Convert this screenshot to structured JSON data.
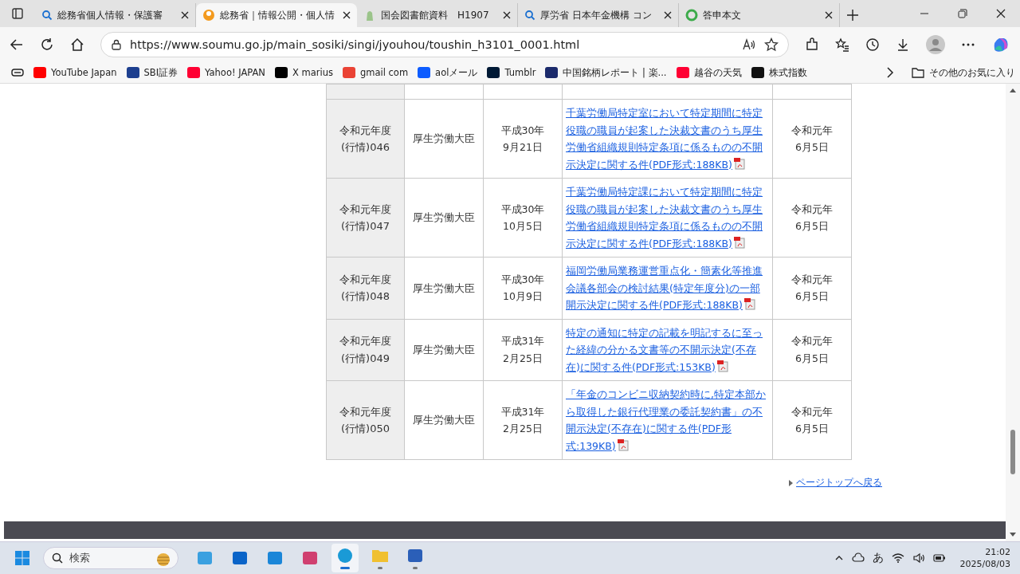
{
  "tabs": [
    {
      "title": "総務省個人情報・保護審",
      "kind": "search",
      "selected": false
    },
    {
      "title": "総務省｜情報公開・個人情",
      "kind": "orange",
      "selected": true
    },
    {
      "title": "国会図書館資料　H1907",
      "kind": "green",
      "selected": false
    },
    {
      "title": "厚労省 日本年金機構 コン",
      "kind": "search",
      "selected": false
    },
    {
      "title": "答申本文",
      "kind": "ring",
      "selected": false
    }
  ],
  "address": {
    "url": "https://www.soumu.go.jp/main_sosiki/singi/jyouhou/toushin_h3101_0001.html"
  },
  "bookmarks": [
    {
      "label": "YouTube Japan",
      "color": "#ff0000"
    },
    {
      "label": "SBI証券",
      "color": "#1d3f8f"
    },
    {
      "label": "Yahoo! JAPAN",
      "color": "#ff0033"
    },
    {
      "label": "X marius",
      "color": "#000000"
    },
    {
      "label": "gmail com",
      "color": "#ea4335"
    },
    {
      "label": "aolメール",
      "color": "#0d5cff"
    },
    {
      "label": "Tumblr",
      "color": "#001935"
    },
    {
      "label": "中国銘柄レポート | 楽...",
      "color": "#1b2a6b"
    },
    {
      "label": "越谷の天気",
      "color": "#ff0033"
    },
    {
      "label": "株式指数",
      "color": "#111111"
    }
  ],
  "other_favorites": "その他のお気に入り",
  "table": {
    "rows": [
      {
        "number": "令和元年度\n(行情)046",
        "minister": "厚生労働大臣",
        "inquiry_date": "平成30年\n9月21日",
        "title": "千葉労働局特定室において特定期間に特定役職の職員が起案した決裁文書のうち厚生労働省組織規則特定条項に係るものの不開示決定に関する件(PDF形式:188KB)",
        "report_date": "令和元年\n6月5日"
      },
      {
        "number": "令和元年度\n(行情)047",
        "minister": "厚生労働大臣",
        "inquiry_date": "平成30年\n10月5日",
        "title": "千葉労働局特定課において特定期間に特定役職の職員が起案した決裁文書のうち厚生労働省組織規則特定条項に係るものの不開示決定に関する件(PDF形式:188KB)",
        "report_date": "令和元年\n6月5日"
      },
      {
        "number": "令和元年度\n(行情)048",
        "minister": "厚生労働大臣",
        "inquiry_date": "平成30年\n10月9日",
        "title": "福岡労働局業務運営重点化・簡素化等推進会議各部会の検討結果(特定年度分)の一部開示決定に関する件(PDF形式:188KB)",
        "report_date": "令和元年\n6月5日"
      },
      {
        "number": "令和元年度\n(行情)049",
        "minister": "厚生労働大臣",
        "inquiry_date": "平成31年\n2月25日",
        "title": "特定の通知に特定の記載を明記するに至った経緯の分かる文書等の不開示決定(不存在)に関する件(PDF形式:153KB)",
        "report_date": "令和元年\n6月5日"
      },
      {
        "number": "令和元年度\n(行情)050",
        "minister": "厚生労働大臣",
        "inquiry_date": "平成31年\n2月25日",
        "title": "「年金のコンビニ収納契約時に,特定本部から取得した銀行代理業の委託契約書」の不開示決定(不存在)に関する件(PDF形式:139KB)",
        "report_date": "令和元年\n6月5日"
      }
    ]
  },
  "page_top_link": "ページトップへ戻る",
  "taskbar": {
    "search_placeholder": "検索",
    "apps": [
      {
        "kind": "paint",
        "running": false,
        "selected": false
      },
      {
        "kind": "outlook",
        "running": false,
        "selected": false
      },
      {
        "kind": "outlook2",
        "running": false,
        "selected": false
      },
      {
        "kind": "snip",
        "running": false,
        "selected": false
      },
      {
        "kind": "edge",
        "running": true,
        "selected": true
      },
      {
        "kind": "folder",
        "running": true,
        "selected": false
      },
      {
        "kind": "word",
        "running": true,
        "selected": false
      }
    ],
    "ime": "あ",
    "time": "21:02",
    "date": "2025/08/03"
  }
}
